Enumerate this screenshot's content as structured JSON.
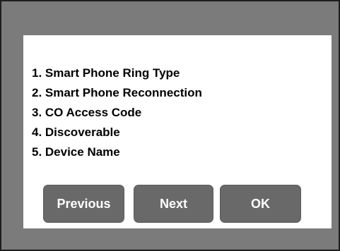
{
  "menu": {
    "items": [
      {
        "label": "1. Smart Phone Ring Type"
      },
      {
        "label": "2. Smart Phone Reconnection"
      },
      {
        "label": "3. CO Access Code"
      },
      {
        "label": "4. Discoverable"
      },
      {
        "label": "5. Device Name"
      }
    ]
  },
  "buttons": {
    "previous_label": "Previous",
    "next_label": "Next",
    "ok_label": "OK"
  },
  "colors": {
    "screen_background": "#7b7b7b",
    "dialog_background": "#ffffff",
    "button_background": "#696969",
    "button_text": "#ffffff"
  }
}
